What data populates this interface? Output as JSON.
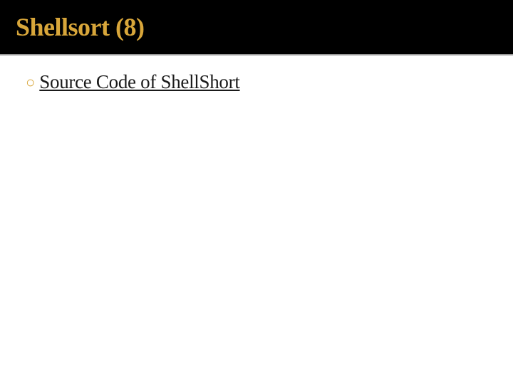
{
  "slide": {
    "title": "Shellsort (8)",
    "bullet": {
      "marker": "○",
      "link_text": "Source Code of ShellShort"
    }
  }
}
